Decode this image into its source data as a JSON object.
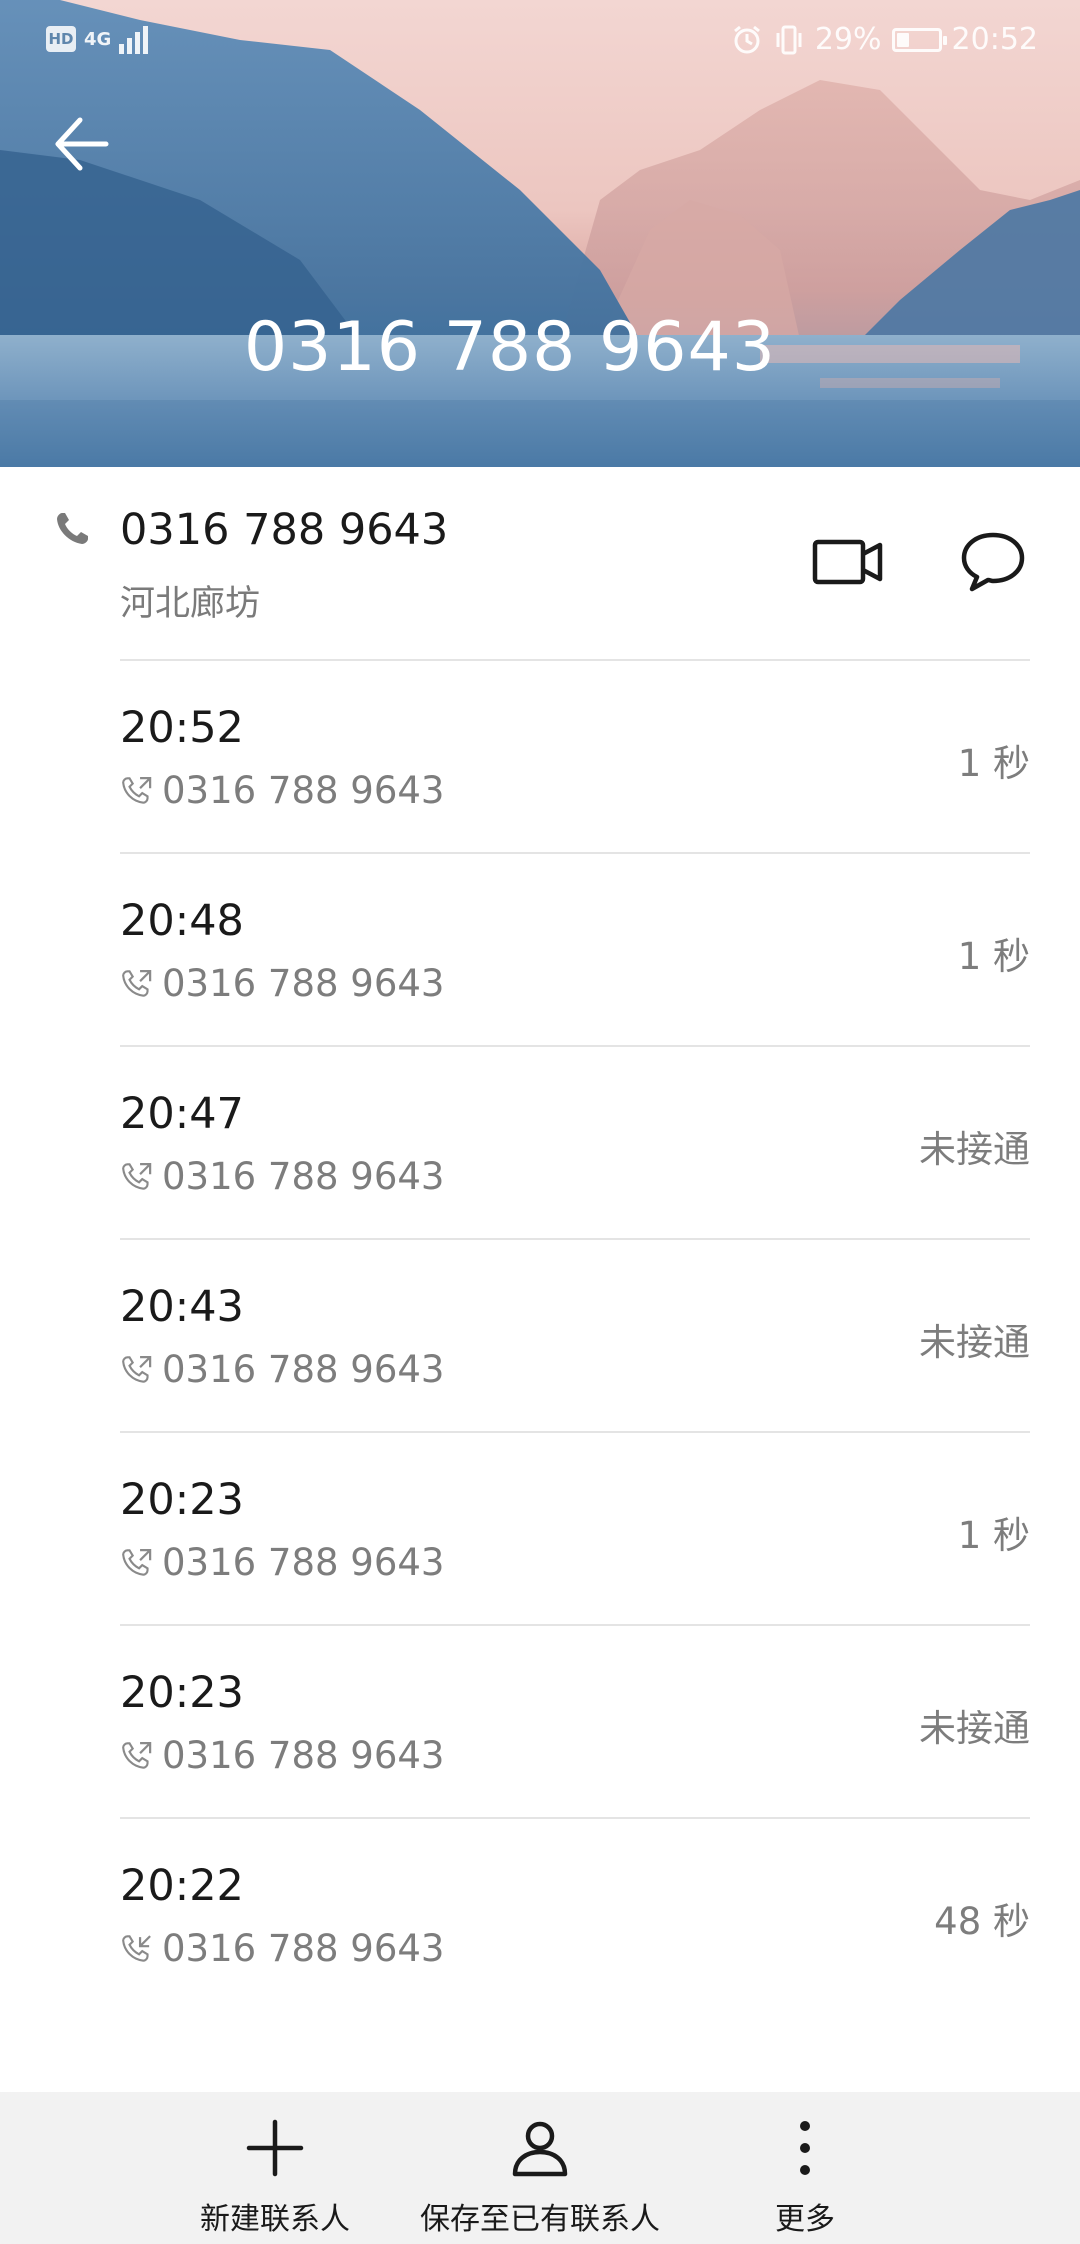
{
  "status_bar": {
    "hd": "HD",
    "network": "4G",
    "battery_percent": "29%",
    "battery_level": 0.29,
    "time": "20:52"
  },
  "header": {
    "number": "0316 788 9643"
  },
  "summary": {
    "number": "0316 788 9643",
    "location": "河北廊坊"
  },
  "calls": [
    {
      "time": "20:52",
      "number": "0316 788 9643",
      "status": "1 秒",
      "direction": "outgoing"
    },
    {
      "time": "20:48",
      "number": "0316 788 9643",
      "status": "1 秒",
      "direction": "outgoing"
    },
    {
      "time": "20:47",
      "number": "0316 788 9643",
      "status": "未接通",
      "direction": "outgoing"
    },
    {
      "time": "20:43",
      "number": "0316 788 9643",
      "status": "未接通",
      "direction": "outgoing"
    },
    {
      "time": "20:23",
      "number": "0316 788 9643",
      "status": "1 秒",
      "direction": "outgoing"
    },
    {
      "time": "20:23",
      "number": "0316 788 9643",
      "status": "未接通",
      "direction": "outgoing"
    },
    {
      "time": "20:22",
      "number": "0316 788 9643",
      "status": "48 秒",
      "direction": "incoming"
    }
  ],
  "actions": {
    "new_contact": "新建联系人",
    "save_existing": "保存至已有联系人",
    "more": "更多"
  },
  "colors": {
    "text_primary": "#1a1a1a",
    "text_secondary": "#7d7d7d",
    "divider": "#e4e4e4",
    "bottom_bar": "#f2f2f2"
  }
}
